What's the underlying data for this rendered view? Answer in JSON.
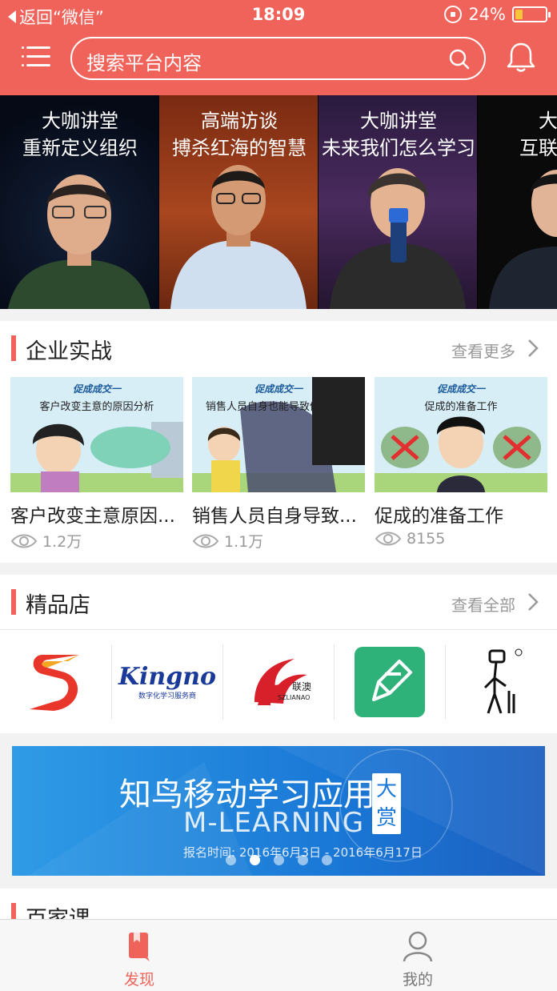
{
  "status_bar": {
    "back_label": "返回“微信”",
    "time": "18:09",
    "battery_text": "24%",
    "battery_level": 0.24
  },
  "header": {
    "search_placeholder": "搜索平台内容"
  },
  "banner": {
    "slides": [
      {
        "line1": "大咖讲堂",
        "line2": "重新定义组织"
      },
      {
        "line1": "高端访谈",
        "line2": "搏杀红海的智慧"
      },
      {
        "line1": "大咖讲堂",
        "line2": "未来我们怎么学习"
      },
      {
        "line1": "大咖",
        "line2": "互联网与"
      }
    ]
  },
  "enterprise": {
    "title": "企业实战",
    "more": "查看更多",
    "courses": [
      {
        "banner": "促成成交一",
        "subtitle": "客户改变主意的原因分析",
        "caption": "客户改变主意原因...",
        "views": "1.2万"
      },
      {
        "banner": "促成成交一",
        "subtitle": "销售人员自身也能导致促成失败",
        "caption": "销售人员自身导致...",
        "views": "1.1万"
      },
      {
        "banner": "促成成交一",
        "subtitle": "促成的准备工作",
        "caption": "促成的准备工作",
        "views": "8155"
      }
    ]
  },
  "boutique": {
    "title": "精品店",
    "more": "查看全部",
    "stores": [
      {
        "name": "s-logo"
      },
      {
        "name": "Kingno",
        "tagline": "数字化学习服务商"
      },
      {
        "name": "联澳",
        "tagline": "SZLIANAO"
      },
      {
        "name": "pencil-app"
      },
      {
        "name": "figure-logo"
      }
    ]
  },
  "ad": {
    "line1": "知鸟移动学习应用",
    "line2": "M-LEARNING",
    "badge": "大赏",
    "line3": "报名时间: 2016年6月3日 - 2016年6月17日",
    "dots": 5,
    "active_dot": 1
  },
  "hundred": {
    "title": "百家课"
  },
  "tabs": [
    {
      "label": "发现",
      "active": true
    },
    {
      "label": "我的",
      "active": false
    }
  ],
  "colors": {
    "accent": "#f0635a",
    "ad_blue": "#1a78d6"
  }
}
